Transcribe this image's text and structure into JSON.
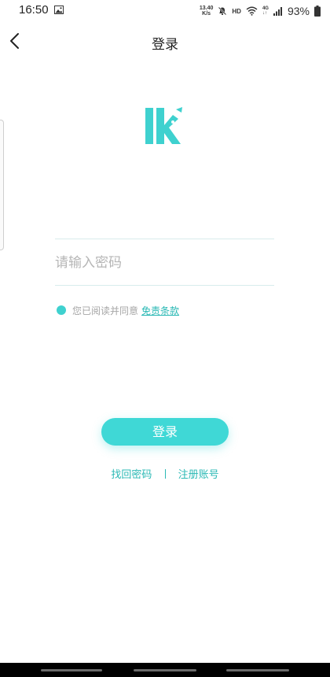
{
  "status_bar": {
    "time": "16:50",
    "net_speed_value": "13.40",
    "net_speed_unit": "K/s",
    "hd": "HD",
    "network": "4G",
    "battery": "93%"
  },
  "header": {
    "title": "登录"
  },
  "form": {
    "account_placeholder": "",
    "password_placeholder": "请输入密码"
  },
  "agreement": {
    "text": "您已阅读并同意",
    "link": "免责条款"
  },
  "login_button": "登录",
  "links": {
    "find_password": "找回密码",
    "register": "注册账号"
  },
  "colors": {
    "accent": "#3fd8d6",
    "link": "#2bb9b5"
  },
  "icons": [
    "image-icon",
    "mute-icon",
    "wifi-icon",
    "signal-icon",
    "battery-icon",
    "back-arrow-icon",
    "app-logo"
  ]
}
